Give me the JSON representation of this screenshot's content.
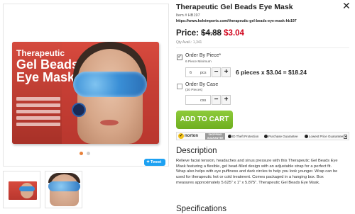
{
  "product": {
    "title": "Therapeutic Gel Beads Eye Mask",
    "item_no": "Item # HB197",
    "url": "https://www.koleimports.com/therapeutic-gel-beads-eye-mask-hb197",
    "price_label": "Price:",
    "old_price": "$4.88",
    "new_price": "$3.04",
    "qty_avail": "Qty Avail.: 1,341",
    "box_title_line1": "Therapeutic",
    "box_title_line2": "Gel Beads",
    "box_title_line3": "Eye Mask"
  },
  "order_by_piece": {
    "label": "Order By Piece*",
    "sub": "6 Piece Minimum",
    "qty_value": "6",
    "qty_unit": "pcs",
    "checked": true,
    "calc": "6 pieces x $3.04 = $18.24"
  },
  "order_by_case": {
    "label": "Order By Case",
    "sub": "(20 Pieces)",
    "qty_value": "",
    "qty_unit": "css",
    "checked": false
  },
  "buttons": {
    "minus": "−",
    "plus": "+",
    "add_to_cart": "ADD TO CART",
    "tweet": "Tweet",
    "close": "✕"
  },
  "trust": {
    "norton": "norton",
    "guarantee": "SHOPPING GUARANTEE",
    "id_theft": "ID Theft Protection",
    "purchase": "Purchase Guarantee",
    "lowest_price": "Lowest Price Guarantee"
  },
  "description": {
    "heading": "Description",
    "body": "Relieve facial tension, headaches and sinus pressure with this Therapeutic Gel Beads Eye Mask featuring a flexible, gel bead-filled design with an adjustable strap for a perfect fit. Wrap also helps with eye puffiness and dark circles to help you look younger. Wrap can be used for therapeutic hot or cold treatment. Comes packaged in a hanging box. Box measures approximately 5.625\" x 1\" x 5.875\". Therapeutic Gel Beads Eye Mask."
  },
  "specifications": {
    "heading": "Specifications"
  },
  "gallery": {
    "dots": [
      "active",
      "inactive"
    ]
  },
  "colors": {
    "price_red": "#d0021b",
    "cart_green": "#7ab929",
    "tweet_blue": "#1da1f2",
    "active_dot": "#e8813a"
  }
}
